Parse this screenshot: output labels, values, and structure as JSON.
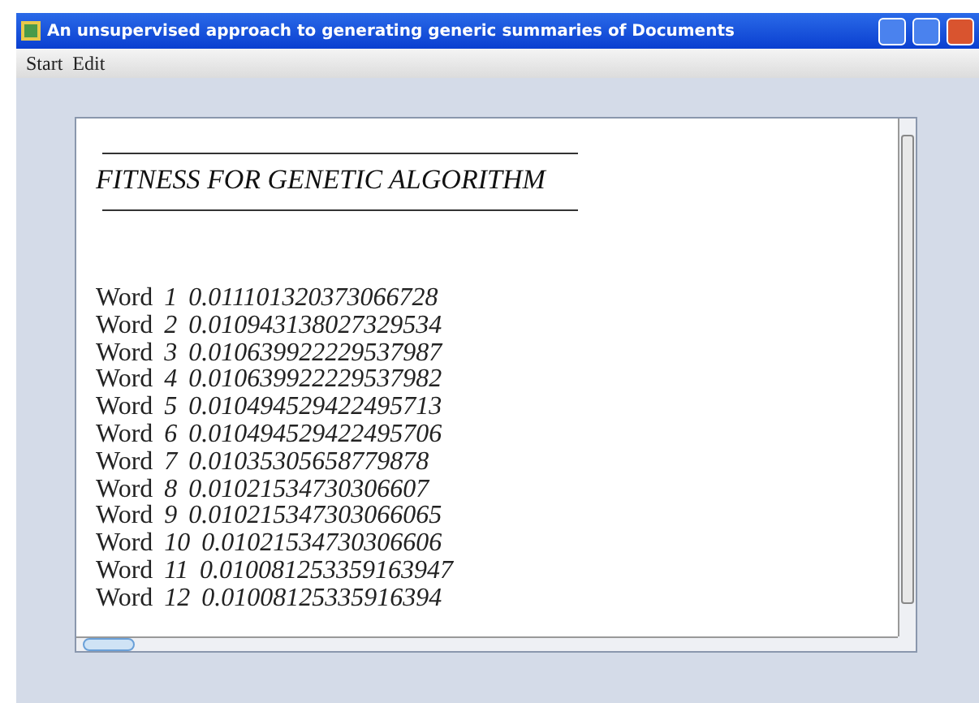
{
  "window": {
    "title": "An unsupervised approach to generating generic summaries of Documents"
  },
  "menu": [
    {
      "label": "Start"
    },
    {
      "label": "Edit"
    }
  ],
  "document": {
    "heading": "FITNESS FOR GENETIC ALGORITHM",
    "lines": [
      "Word *1 0.011101320373066728*",
      "Word *2 0.010943138027329534*",
      "Word *3 0.010639922229537987*",
      "Word *4 0.010639922229537982*",
      "Word *5 0.010494529422495713*",
      "Word *6 0.010494529422495706*",
      "Word *7 0.01035305658779878*",
      "Word *8 0.01021534730306607*",
      "Word *9 0.010215347303066065*",
      "Word *10 0.01021534730306606*",
      "Word *11 0.010081253359163947*",
      "Word *12 0.01008125335916394*"
    ]
  }
}
